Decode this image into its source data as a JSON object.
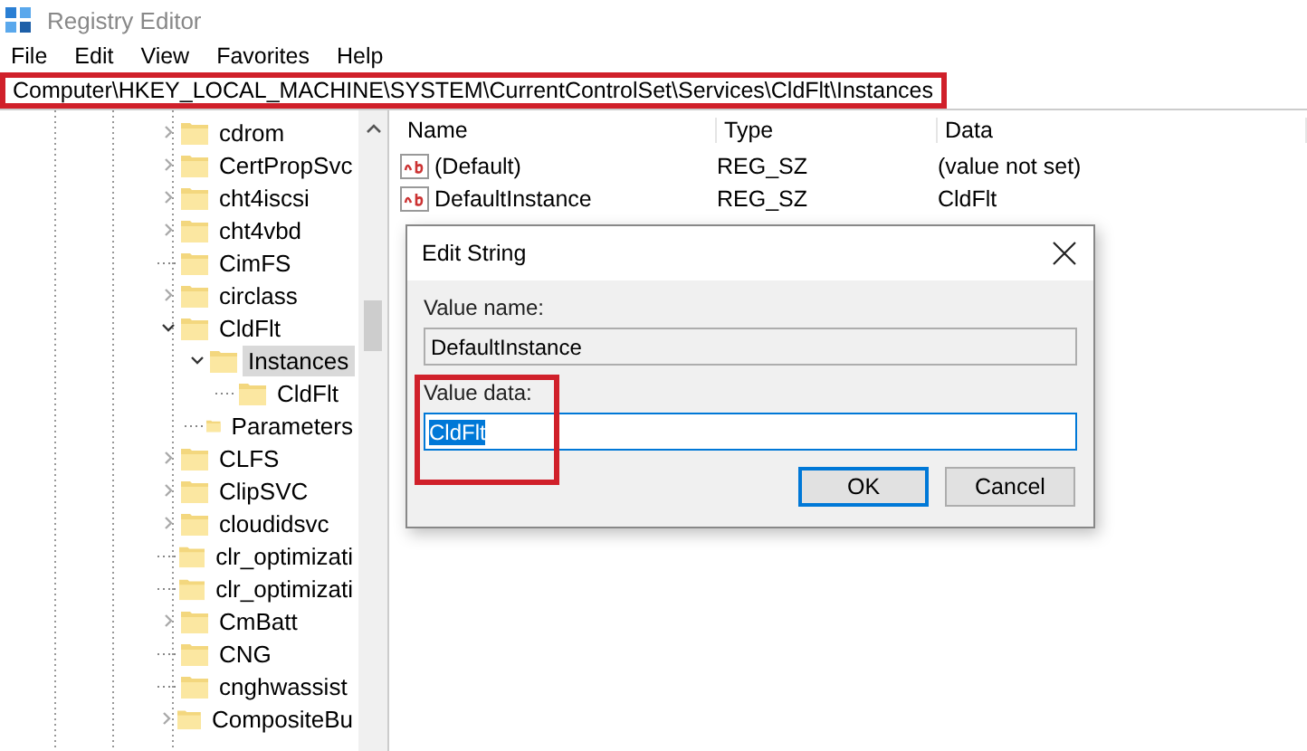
{
  "window": {
    "title": "Registry Editor"
  },
  "menu": [
    {
      "label": "File"
    },
    {
      "label": "Edit"
    },
    {
      "label": "View"
    },
    {
      "label": "Favorites"
    },
    {
      "label": "Help"
    }
  ],
  "address_bar": {
    "path": "Computer\\HKEY_LOCAL_MACHINE\\SYSTEM\\CurrentControlSet\\Services\\CldFlt\\Instances",
    "highlighted": true
  },
  "tree": [
    {
      "label": "cdrom",
      "kind": "collapsed",
      "selected": false
    },
    {
      "label": "CertPropSvc",
      "kind": "collapsed",
      "selected": false
    },
    {
      "label": "cht4iscsi",
      "kind": "collapsed",
      "selected": false
    },
    {
      "label": "cht4vbd",
      "kind": "collapsed",
      "selected": false
    },
    {
      "label": "CimFS",
      "kind": "leaf",
      "selected": false
    },
    {
      "label": "circlass",
      "kind": "collapsed",
      "selected": false
    },
    {
      "label": "CldFlt",
      "kind": "expanded",
      "selected": false,
      "children": [
        {
          "label": "Instances",
          "kind": "expanded",
          "selected": true,
          "children": [
            {
              "label": "CldFlt",
              "kind": "leaf",
              "selected": false
            }
          ]
        },
        {
          "label": "Parameters",
          "kind": "leaf",
          "selected": false
        }
      ]
    },
    {
      "label": "CLFS",
      "kind": "collapsed",
      "selected": false
    },
    {
      "label": "ClipSVC",
      "kind": "collapsed",
      "selected": false
    },
    {
      "label": "cloudidsvc",
      "kind": "collapsed",
      "selected": false
    },
    {
      "label": "clr_optimizati",
      "kind": "leaf",
      "selected": false
    },
    {
      "label": "clr_optimizati",
      "kind": "leaf",
      "selected": false
    },
    {
      "label": "CmBatt",
      "kind": "collapsed",
      "selected": false
    },
    {
      "label": "CNG",
      "kind": "leaf",
      "selected": false
    },
    {
      "label": "cnghwassist",
      "kind": "leaf",
      "selected": false
    },
    {
      "label": "CompositeBu",
      "kind": "collapsed",
      "selected": false
    }
  ],
  "values": {
    "columns": [
      "Name",
      "Type",
      "Data"
    ],
    "rows": [
      {
        "name": "(Default)",
        "type": "REG_SZ",
        "data": "(value not set)"
      },
      {
        "name": "DefaultInstance",
        "type": "REG_SZ",
        "data": "CldFlt"
      }
    ]
  },
  "dialog": {
    "title": "Edit String",
    "value_name_label": "Value name:",
    "value_name": "DefaultInstance",
    "value_data_label": "Value data:",
    "value_data": "CldFlt",
    "value_data_selected": true,
    "highlighted": true,
    "buttons": [
      {
        "label": "OK",
        "default": true
      },
      {
        "label": "Cancel",
        "default": false
      }
    ]
  }
}
